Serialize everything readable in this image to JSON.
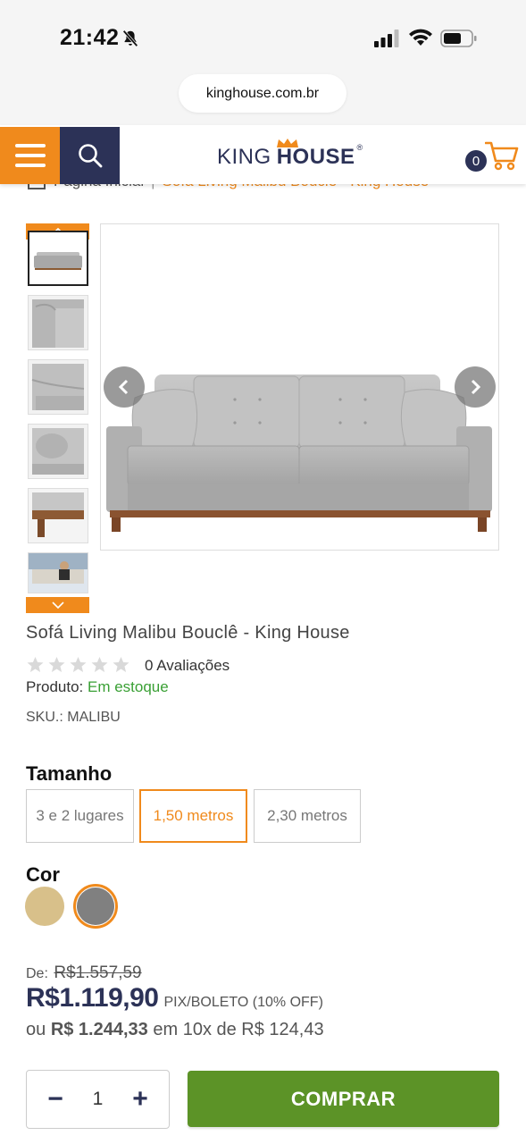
{
  "status_bar": {
    "time": "21:42"
  },
  "browser": {
    "url": "kinghouse.com.br"
  },
  "header": {
    "logo_king": "KING",
    "logo_house": "HOUSE",
    "logo_reg": "®",
    "cart_count": "0"
  },
  "breadcrumb": {
    "home": "Página Inicial",
    "separator": "|",
    "current": "Sofá Living Malibu Bouclê - King House"
  },
  "product": {
    "title": "Sofá Living Malibu Bouclê - King House",
    "rating": 0,
    "reviews": "0 Avaliações",
    "stock_label": "Produto:",
    "stock_status": "Em estoque",
    "sku": "SKU.: MALIBU",
    "size_label": "Tamanho",
    "sizes": [
      "3 e 2 lugares",
      "1,50 metros",
      "2,30 metros"
    ],
    "selected_size": "1,50 metros",
    "color_label": "Cor",
    "colors": [
      "#d8c08a",
      "#808080"
    ],
    "selected_color": "#808080"
  },
  "pricing": {
    "from_label": "De:",
    "old_price": "R$1.557,59",
    "price": "R$1.119,90",
    "price_note": "PIX/BOLETO (10% OFF)",
    "inst_prefix": "ou",
    "inst_total": "R$ 1.244,33",
    "inst_text": "em 10x de R$ 124,43"
  },
  "purchase": {
    "quantity": "1",
    "minus": "−",
    "plus": "+",
    "buy_label": "COMPRAR"
  },
  "colors": {
    "accent_orange": "#f08a1c",
    "navy": "#2c3257",
    "buy_green": "#5c9327",
    "stock_green": "#3aa035"
  }
}
